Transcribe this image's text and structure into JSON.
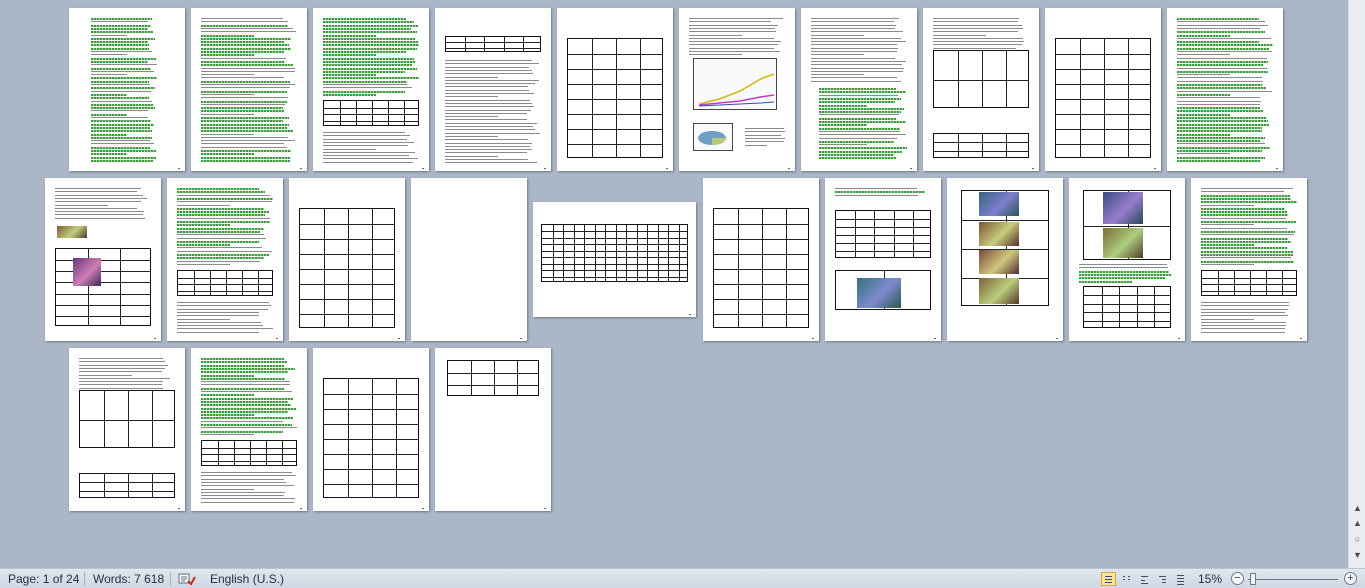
{
  "status_bar": {
    "page_label": "Page: 1 of 24",
    "words_label": "Words: 7 618",
    "language": "English (U.S.)",
    "zoom": "15%",
    "zoom_out_symbol": "−",
    "zoom_in_symbol": "+"
  },
  "icons": {
    "proofing": "spell-check-icon",
    "print_layout": "print-layout-view-icon",
    "full_screen": "full-screen-reading-icon",
    "web_layout": "web-layout-icon",
    "outline": "outline-view-icon",
    "draft": "draft-view-icon",
    "scroll_up": "scroll-up-icon",
    "scroll_down": "scroll-down-icon",
    "browse_object": "browse-object-icon",
    "prev_page": "previous-page-icon",
    "next_page": "next-page-icon"
  },
  "colors": {
    "workspace": "#abb6c6",
    "page": "#ffffff",
    "grammar_underline": "#3e9a3e",
    "active_view": "#fbe39a"
  },
  "document": {
    "total_pages": 24,
    "layout": "multi-page thumbnail view"
  }
}
